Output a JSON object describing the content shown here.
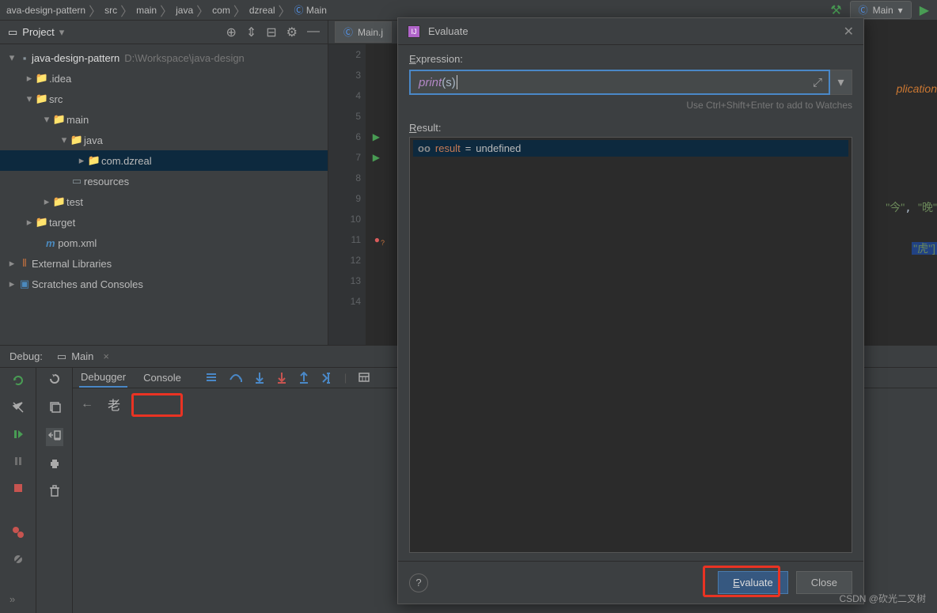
{
  "breadcrumb": {
    "items": [
      "ava-design-pattern",
      "src",
      "main",
      "java",
      "com",
      "dzreal",
      "Main"
    ],
    "run_config": "Main"
  },
  "project_header": {
    "title": "Project"
  },
  "tree": {
    "root": {
      "name": "java-design-pattern",
      "path": "D:\\Workspace\\java-design"
    },
    "idea": ".idea",
    "src": "src",
    "main": "main",
    "java": "java",
    "pkg": "com.dzreal",
    "resources": "resources",
    "test": "test",
    "target": "target",
    "pom": "pom.xml",
    "ext": "External Libraries",
    "scratch": "Scratches and Consoles"
  },
  "editor": {
    "tab": "Main.j",
    "lines": [
      "2",
      "3",
      "4",
      "5",
      "6",
      "7",
      "8",
      "9",
      "10",
      "11",
      "12",
      "13",
      "14"
    ],
    "frag_key": "plication",
    "frag_str1": "\"今\"",
    "frag_str2": "\"晚\"",
    "frag_str3": "\"虎\"]"
  },
  "debug": {
    "title": "Debug:",
    "tab": "Main",
    "tabs": {
      "debugger": "Debugger",
      "console": "Console"
    },
    "frame_text": "老"
  },
  "dialog": {
    "title": "Evaluate",
    "expr_label": "Expression:",
    "expr_fn": "print",
    "expr_open": "(",
    "expr_var": "s",
    "expr_close": ")",
    "hint": "Use Ctrl+Shift+Enter to add to Watches",
    "result_label": "Result:",
    "result_name": "result",
    "result_eq": " = ",
    "result_val": "undefined",
    "evaluate": "Evaluate",
    "close": "Close",
    "help": "?"
  },
  "watermark": "CSDN @砍光二叉树"
}
